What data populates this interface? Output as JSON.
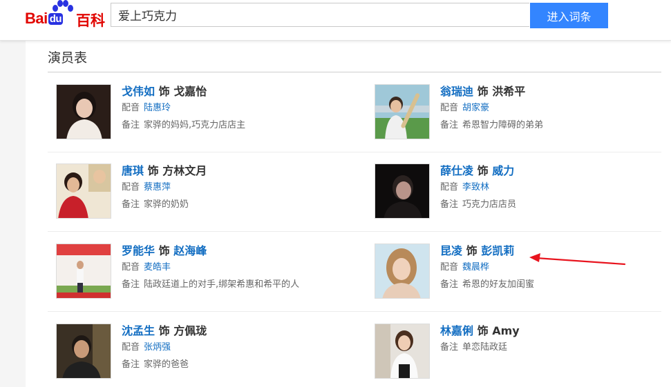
{
  "header": {
    "logo_text": "Bai",
    "logo_du": "du",
    "logo_baike": "百科",
    "search_value": "爱上巧克力",
    "search_button": "进入词条"
  },
  "section": {
    "title": "演员表"
  },
  "labels": {
    "conn": "饰",
    "voice": "配音",
    "note": "备注"
  },
  "actors": [
    {
      "actor": "戈伟如",
      "role": "戈嘉怡",
      "role_link": false,
      "voice": "陆惠玲",
      "note": "家骅的妈妈,巧克力店店主"
    },
    {
      "actor": "翁瑞迪",
      "role": "洪希平",
      "role_link": false,
      "voice": "胡家豪",
      "note": "希恩智力障碍的弟弟"
    },
    {
      "actor": "唐琪",
      "role": "方林文月",
      "role_link": false,
      "voice": "蔡惠萍",
      "note": "家骅的奶奶"
    },
    {
      "actor": "薛仕凌",
      "role": "威力",
      "role_link": true,
      "voice": "李致林",
      "note": "巧克力店店员"
    },
    {
      "actor": "罗能华",
      "role": "赵海峰",
      "role_link": true,
      "voice": "麦皓丰",
      "note": "陆政廷道上的对手,绑架希惠和希平的人"
    },
    {
      "actor": "昆凌",
      "role": "彭凯莉",
      "role_link": true,
      "voice": "魏晨桦",
      "note": "希恩的好友加闺蜜"
    },
    {
      "actor": "沈孟生",
      "role": "方佩珑",
      "role_link": false,
      "voice": "张炳强",
      "note": "家骅的爸爸"
    },
    {
      "actor": "林嘉俐",
      "role": "Amy",
      "role_link": false,
      "voice": "",
      "note": "单恋陆政廷"
    }
  ]
}
